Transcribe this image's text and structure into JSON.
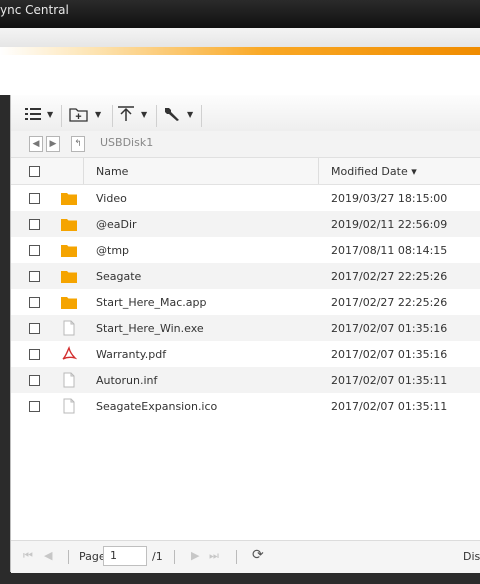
{
  "app": {
    "title": "ync Central"
  },
  "path": {
    "current": "USBDisk1"
  },
  "table": {
    "columns": {
      "name": "Name",
      "modified": "Modified Date ▾"
    },
    "rows": [
      {
        "name": "Video",
        "modified": "2019/03/27 18:15:00",
        "type": "folder"
      },
      {
        "name": "@eaDir",
        "modified": "2019/02/11 22:56:09",
        "type": "folder"
      },
      {
        "name": "@tmp",
        "modified": "2017/08/11 08:14:15",
        "type": "folder"
      },
      {
        "name": "Seagate",
        "modified": "2017/02/27 22:25:26",
        "type": "folder"
      },
      {
        "name": "Start_Here_Mac.app",
        "modified": "2017/02/27 22:25:26",
        "type": "folder"
      },
      {
        "name": "Start_Here_Win.exe",
        "modified": "2017/02/07 01:35:16",
        "type": "file"
      },
      {
        "name": "Warranty.pdf",
        "modified": "2017/02/07 01:35:16",
        "type": "pdf"
      },
      {
        "name": "Autorun.inf",
        "modified": "2017/02/07 01:35:11",
        "type": "file"
      },
      {
        "name": "SeagateExpansion.ico",
        "modified": "2017/02/07 01:35:11",
        "type": "file"
      }
    ]
  },
  "pagination": {
    "page_label": "Page",
    "page_value": "1",
    "total": "/1",
    "display_label": "Disp"
  },
  "colors": {
    "folder": "#f5a400",
    "pdf": "#d32f2f",
    "accent": "#f08c00"
  }
}
